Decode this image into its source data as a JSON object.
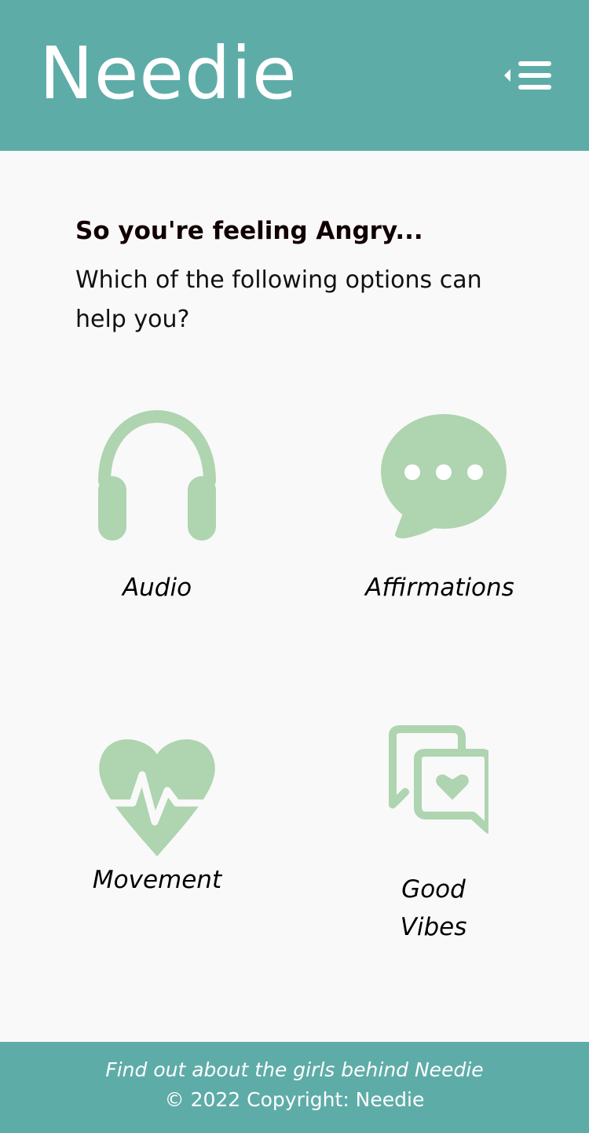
{
  "header": {
    "brand": "Needie",
    "menu_icon": "menu-collapse-icon"
  },
  "main": {
    "title": "So you're feeling Angry...",
    "subtitle": "Which of the following options can help you?",
    "options": [
      {
        "label": "Audio",
        "icon": "headphones-icon"
      },
      {
        "label": "Affirmations",
        "icon": "speech-bubble-icon"
      },
      {
        "label": "Movement",
        "icon": "heartbeat-icon"
      },
      {
        "label": "Good Vibes",
        "icon": "chat-heart-icon"
      }
    ]
  },
  "footer": {
    "link_text": "Find out about the girls behind Needie",
    "copyright": "© 2022 Copyright: Needie"
  },
  "colors": {
    "header_bg": "#5eaca8",
    "icon_green": "#aed4b0",
    "page_bg": "#f9f9f9"
  }
}
